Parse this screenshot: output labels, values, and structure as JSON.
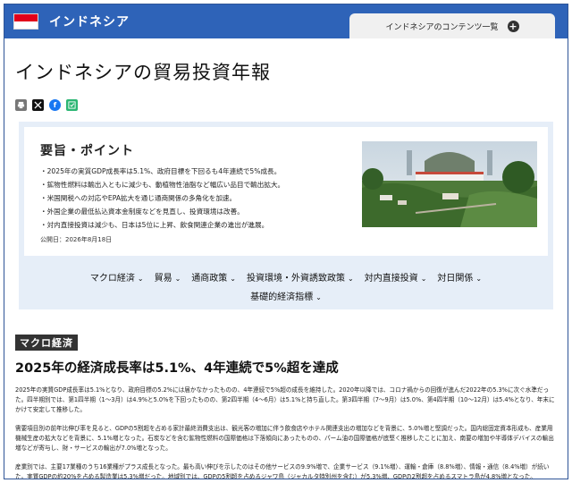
{
  "header": {
    "country": "インドネシア",
    "contents_tab": "インドネシアのコンテンツ一覧",
    "flag_colors": {
      "top": "#e2001a",
      "bottom": "#ffffff"
    },
    "bar_color": "#2e63b8"
  },
  "page": {
    "title": "インドネシアの貿易投資年報"
  },
  "share": {
    "icons": [
      "print-icon",
      "x-icon",
      "facebook-icon",
      "hatena-icon"
    ]
  },
  "summary": {
    "heading": "要旨・ポイント",
    "points": [
      "2025年の実質GDP成長率は5.1%、政府目標を下回るも4年連続で5%成長。",
      "鉱物性燃料は輸出入ともに減少も、動植物性油脂など幅広い品目で輸出拡大。",
      "米国関税への対応やEPA拡大を通じ通商関係の多角化を加速。",
      "外国企業の最低払込資本金制度などを見直し、投資環境は改善。",
      "対内直接投資は減少も、日本は5位に上昇、飲食関連企業の進出が進展。"
    ],
    "published": "公開日：2026年8月18日"
  },
  "nav": {
    "row1": [
      "マクロ経済",
      "貿易",
      "通商政策",
      "投資環境・外資誘致政策",
      "対内直接投資",
      "対日関係"
    ],
    "row2": [
      "基礎的経済指標"
    ]
  },
  "section": {
    "tag": "マクロ経済",
    "title": "2025年の経済成長率は5.1%、4年連続で5%超を達成",
    "paragraphs": [
      "2025年の実質GDP成長率は5.1%となり、政府目標の5.2%には届かなかったものの、4年連続で5%超の成長を維持した。2020年以降では、コロナ禍からの回復が進んだ2022年の5.3%に次ぐ水準だった。四半期別では、第1四半期（1～3月）は4.9%と5.0%を下回ったものの、第2四半期（4～6月）は5.1%と持ち直した。第3四半期（7～9月）は5.0%、第4四半期（10～12月）は5.4%となり、年末にかけて安定して推移した。",
      "需要項目別の前年比伸び率を見ると、GDPの5割超を占める家計最終消費支出は、観光客の増加に伴う飲食店やホテル関連支出の増加などを背景に、5.0%増と堅調だった。国内総固定資本形成も、産業用機械生産の拡大などを背景に、5.1%増となった。石炭などを含む鉱物性燃料の国際価格は下落傾向にあったものの、パーム油の国際価格が底堅く推移したことに加え、南要の増加や半導体デバイスの輸出増などが寄与し、財・サービスの輸出が7.0%増となった。",
      "産業別では、主要17業種のうち16業種がプラス成長となった。最も高い伸びを示したのはその他サービスの9.9%増で、企業サービス（9.1%増）、運輸・倉庫（8.8%増）、情報・通信（8.4%増）が続いた。実質GDPの約20%を占める製造業は5.3%増だった。地域別では、GDPの5割超を占めるジャワ島（ジャカルタ特別州を含む）が5.3%増、GDPの2割超を占めるスマトラ島が4.8%増となった。"
    ]
  }
}
